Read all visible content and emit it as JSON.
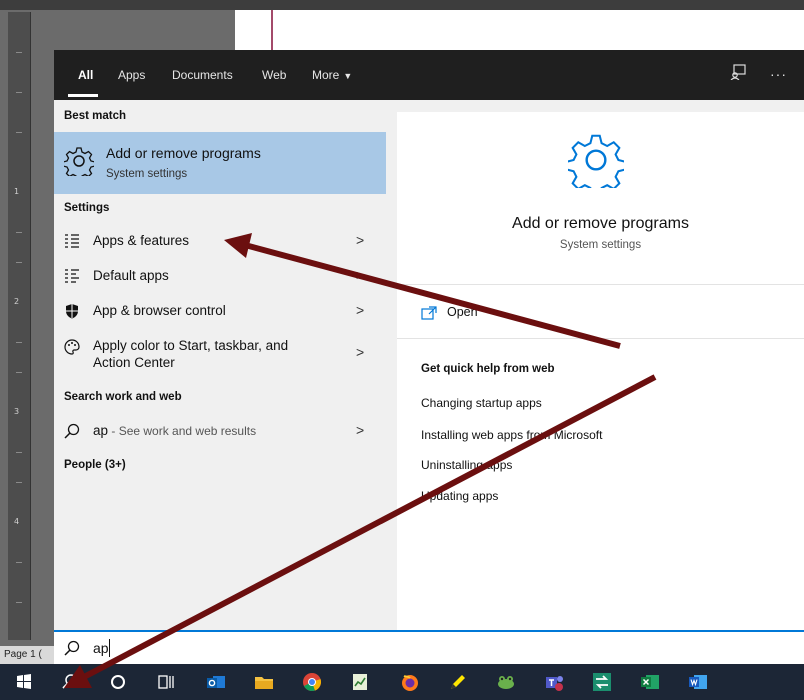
{
  "background": {
    "status_text": "Page 1 ("
  },
  "tabs": [
    "All",
    "Apps",
    "Documents",
    "Web",
    "More"
  ],
  "sections": {
    "best_match": "Best match",
    "settings": "Settings",
    "search_web": "Search work and web",
    "people": "People (3+)"
  },
  "best_match": {
    "title": "Add or remove programs",
    "subtitle": "System settings"
  },
  "settings_items": [
    {
      "label": "Apps & features",
      "icon": "list-icon"
    },
    {
      "label": "Default apps",
      "icon": "default-apps-icon"
    },
    {
      "label": "App & browser control",
      "icon": "shield-icon"
    },
    {
      "label": "Apply color to Start, taskbar, and Action Center",
      "icon": "palette-icon"
    }
  ],
  "web_result": {
    "query": "ap",
    "suffix": " - See work and web results"
  },
  "detail": {
    "title": "Add or remove programs",
    "subtitle": "System settings",
    "open_label": "Open",
    "help_title": "Get quick help from web",
    "help_links": [
      "Changing startup apps",
      "Installing web apps from Microsoft",
      "Uninstalling apps",
      "Updating apps"
    ]
  },
  "search": {
    "value": "ap"
  },
  "chevron": ">",
  "taskbar_icons": [
    "windows-start-icon",
    "search-icon",
    "cortana-icon",
    "task-view-icon",
    "outlook-icon",
    "file-explorer-icon",
    "chrome-icon",
    "sheets-icon",
    "firefox-icon",
    "pencil-icon",
    "frog-icon",
    "teams-icon",
    "transfer-icon",
    "excel-icon",
    "word-icon"
  ],
  "colors": {
    "accent": "#0078d7",
    "highlight": "#a8c8e6",
    "arrow": "#6b0f0f",
    "topbar": "#1f1f1f"
  }
}
